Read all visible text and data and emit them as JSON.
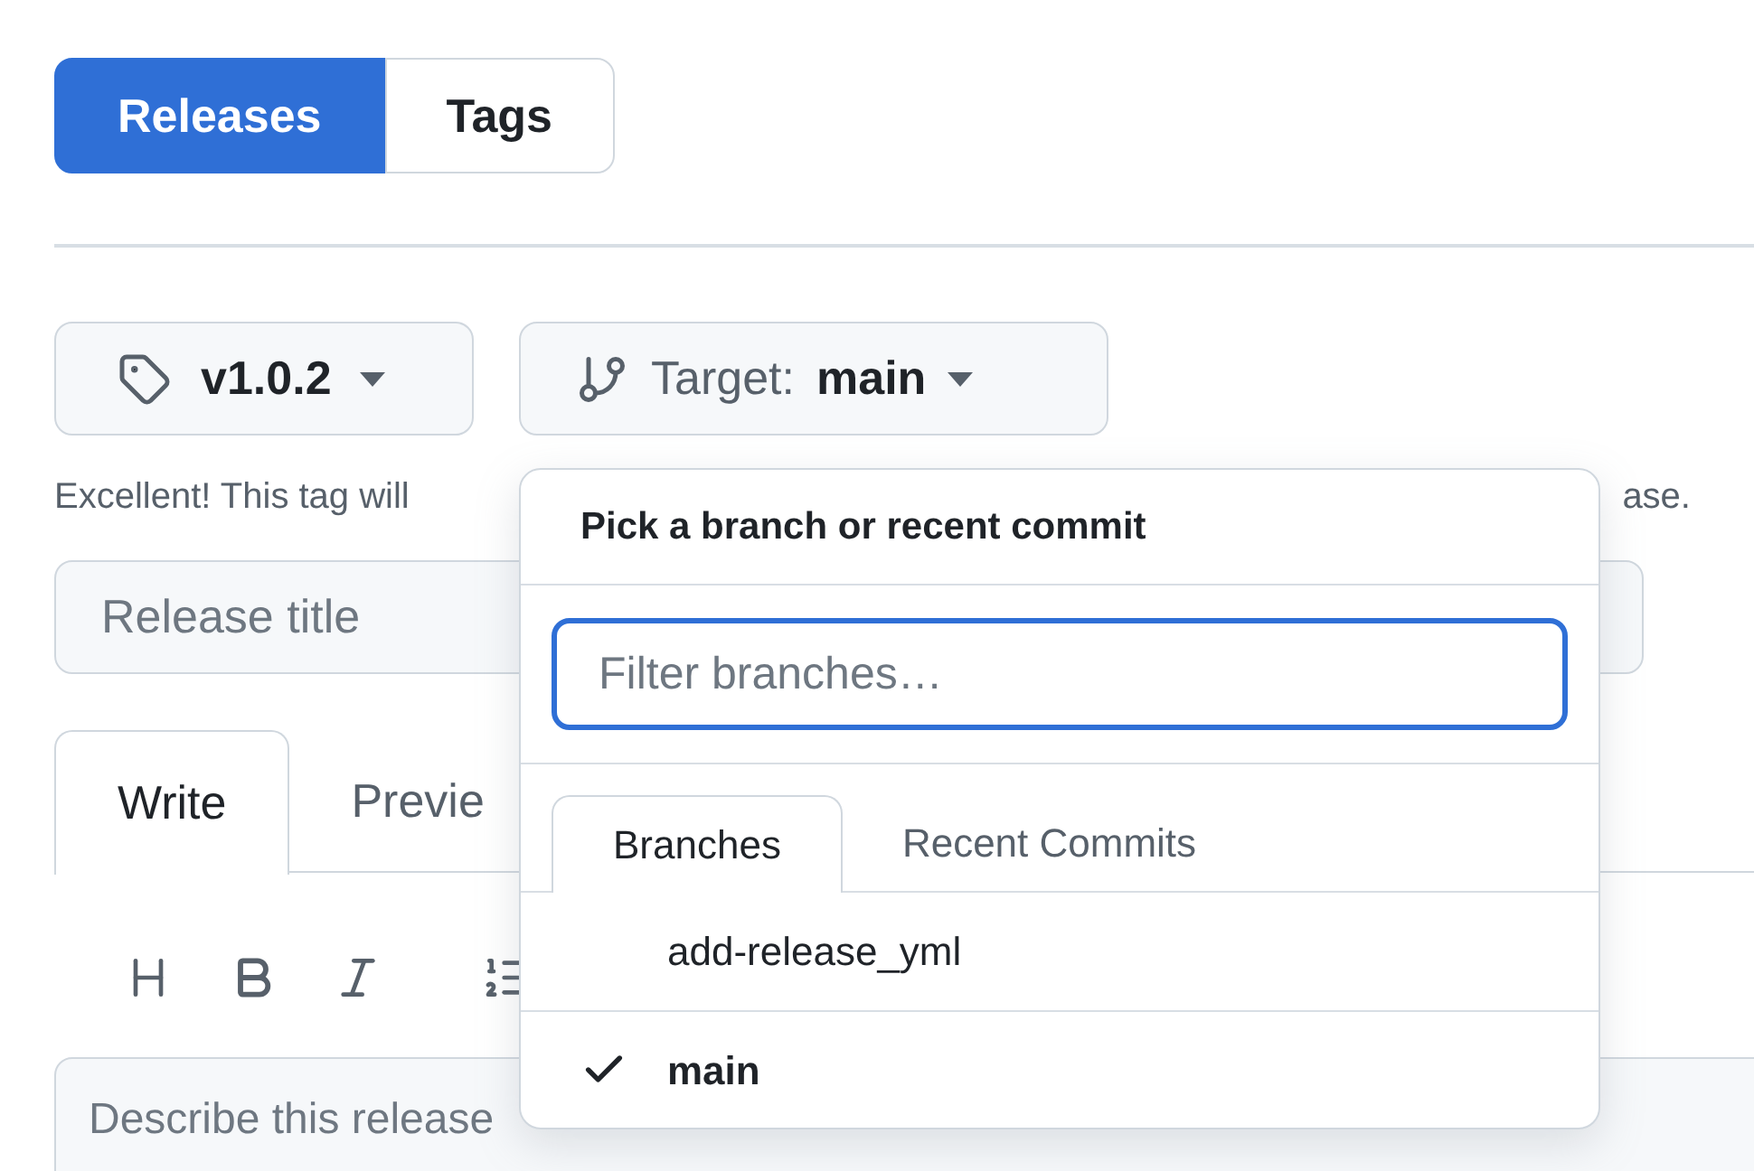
{
  "view_switch": [
    {
      "label": "Releases",
      "selected": true
    },
    {
      "label": "Tags",
      "selected": false
    }
  ],
  "tag_button": {
    "label": "v1.0.2"
  },
  "target_button": {
    "prefix": "Target:",
    "branch": "main"
  },
  "hint": {
    "start": "Excellent! This tag will",
    "end": "ase."
  },
  "title_field": {
    "placeholder": "Release title"
  },
  "editor_tabs": [
    {
      "label": "Write",
      "selected": true
    },
    {
      "label": "Previe",
      "selected": false
    }
  ],
  "description_field": {
    "placeholder": "Describe this release"
  },
  "branch_menu": {
    "title": "Pick a branch or recent commit",
    "filter": {
      "placeholder": "Filter branches…"
    },
    "tabs": [
      {
        "label": "Branches",
        "selected": true
      },
      {
        "label": "Recent Commits",
        "selected": false
      }
    ],
    "items": [
      {
        "label": "add-release_yml",
        "selected": false
      },
      {
        "label": "main",
        "selected": true
      }
    ]
  }
}
